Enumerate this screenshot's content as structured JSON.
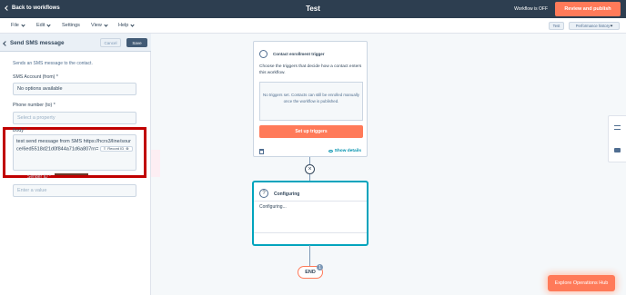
{
  "topbar": {
    "back_label": "Back to workflows",
    "title": "Test",
    "status": "Workflow is OFF",
    "publish_label": "Review and publish"
  },
  "menubar": {
    "file": "File",
    "edit": "Edit",
    "settings": "Settings",
    "view": "View",
    "help": "Help",
    "test": "Test",
    "performance": "Performance history"
  },
  "panel": {
    "title": "Send SMS message",
    "cancel": "Cancel",
    "save": "Save",
    "description": "Sends an SMS message to the contact.",
    "sms_account_label": "SMS Account (from) *",
    "sms_account_value": "No options available",
    "phone_label": "Phone number (to) *",
    "phone_placeholder": "Select a property",
    "body_label": "Body *",
    "body_text": "test send message from SMS https://hcrs3/line/source/6ed5518d21d0f844a71d6a807rn=",
    "token_label": "Record ID",
    "cut_label": "Sender ID *",
    "value_placeholder": "Enter a value"
  },
  "canvas": {
    "trigger_title": "Contact enrollment trigger",
    "trigger_desc": "Choose the triggers that decide how a contact enters this workflow.",
    "no_triggers": "No triggers set. Contacts can still be enrolled manually once the workflow is published.",
    "setup_label": "Set up triggers",
    "show_details": "Show details",
    "action_title": "Configuring",
    "action_body": "Configuring...",
    "end_label": "END",
    "end_badge": "1"
  },
  "footer": {
    "explore_label": "Explore Operations Hub"
  }
}
